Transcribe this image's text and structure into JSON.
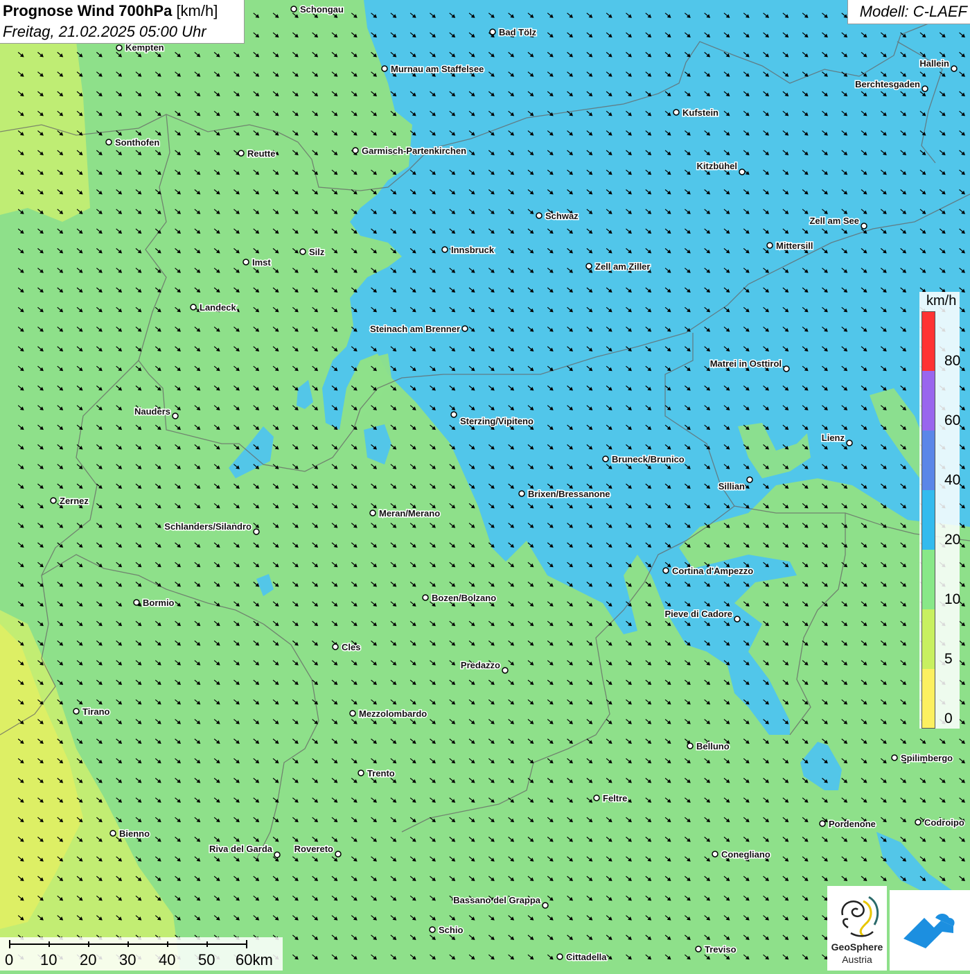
{
  "header": {
    "title_bold": "Prognose Wind 700hPa",
    "title_unit": "[km/h]",
    "datetime": "Freitag, 21.02.2025 05:00 Uhr",
    "model": "Modell: C-LAEF"
  },
  "legend": {
    "unit": "km/h",
    "labels": [
      "80",
      "60",
      "40",
      "20",
      "10",
      "5",
      "0"
    ],
    "colors": [
      "#ff3333",
      "#9966ee",
      "#5b86e8",
      "#33bbee",
      "#88e888",
      "#c8f060",
      "#fcf060"
    ]
  },
  "scale_bar": {
    "labels": [
      "0",
      "10",
      "20",
      "30",
      "40",
      "50",
      "60km"
    ]
  },
  "logos": {
    "geosphere_name": "GeoSphere",
    "geosphere_sub": "Austria"
  },
  "colors": {
    "calm_yellow_green": "#c8ee70",
    "light_green": "#8ee08a",
    "blue_20_40": "#4cc3f2",
    "city_dot": "#ffffff",
    "arrow": "#000000"
  },
  "wind": {
    "direction": "from north-west",
    "arrow_icon": "arrow-southeast-icon"
  },
  "cities": [
    {
      "name": "Schongau"
    },
    {
      "name": "Kempten"
    },
    {
      "name": "Bad Tölz"
    },
    {
      "name": "Murnau am Staffelsee"
    },
    {
      "name": "Hallein"
    },
    {
      "name": "Berchtesgaden"
    },
    {
      "name": "Kufstein"
    },
    {
      "name": "Sonthofen"
    },
    {
      "name": "Reutte"
    },
    {
      "name": "Garmisch-Partenkirchen"
    },
    {
      "name": "Kitzbühel"
    },
    {
      "name": "Schwaz"
    },
    {
      "name": "Zell am See"
    },
    {
      "name": "Innsbruck"
    },
    {
      "name": "Mittersill"
    },
    {
      "name": "Silz"
    },
    {
      "name": "Imst"
    },
    {
      "name": "Zell am Ziller"
    },
    {
      "name": "Landeck"
    },
    {
      "name": "Steinach am Brenner"
    },
    {
      "name": "Matrei in Osttirol"
    },
    {
      "name": "Nauders"
    },
    {
      "name": "Sterzing/Vipiteno"
    },
    {
      "name": "Lienz"
    },
    {
      "name": "Bruneck/Brunico"
    },
    {
      "name": "Sillian"
    },
    {
      "name": "Brixen/Bressanone"
    },
    {
      "name": "Zernez"
    },
    {
      "name": "Meran/Merano"
    },
    {
      "name": "Schlanders/Silandro"
    },
    {
      "name": "Cortina d'Ampezzo"
    },
    {
      "name": "Bozen/Bolzano"
    },
    {
      "name": "Bormio"
    },
    {
      "name": "Pieve di Cadore"
    },
    {
      "name": "Cles"
    },
    {
      "name": "Predazzo"
    },
    {
      "name": "Tirano"
    },
    {
      "name": "Mezzolombardo"
    },
    {
      "name": "Belluno"
    },
    {
      "name": "Spilimbergo"
    },
    {
      "name": "Trento"
    },
    {
      "name": "Feltre"
    },
    {
      "name": "Pordenone"
    },
    {
      "name": "Codroipo"
    },
    {
      "name": "Bienno"
    },
    {
      "name": "Riva del Garda"
    },
    {
      "name": "Rovereto"
    },
    {
      "name": "Conegliano"
    },
    {
      "name": "Bassano del Grappa"
    },
    {
      "name": "Schio"
    },
    {
      "name": "Treviso"
    },
    {
      "name": "Cittadella"
    }
  ]
}
